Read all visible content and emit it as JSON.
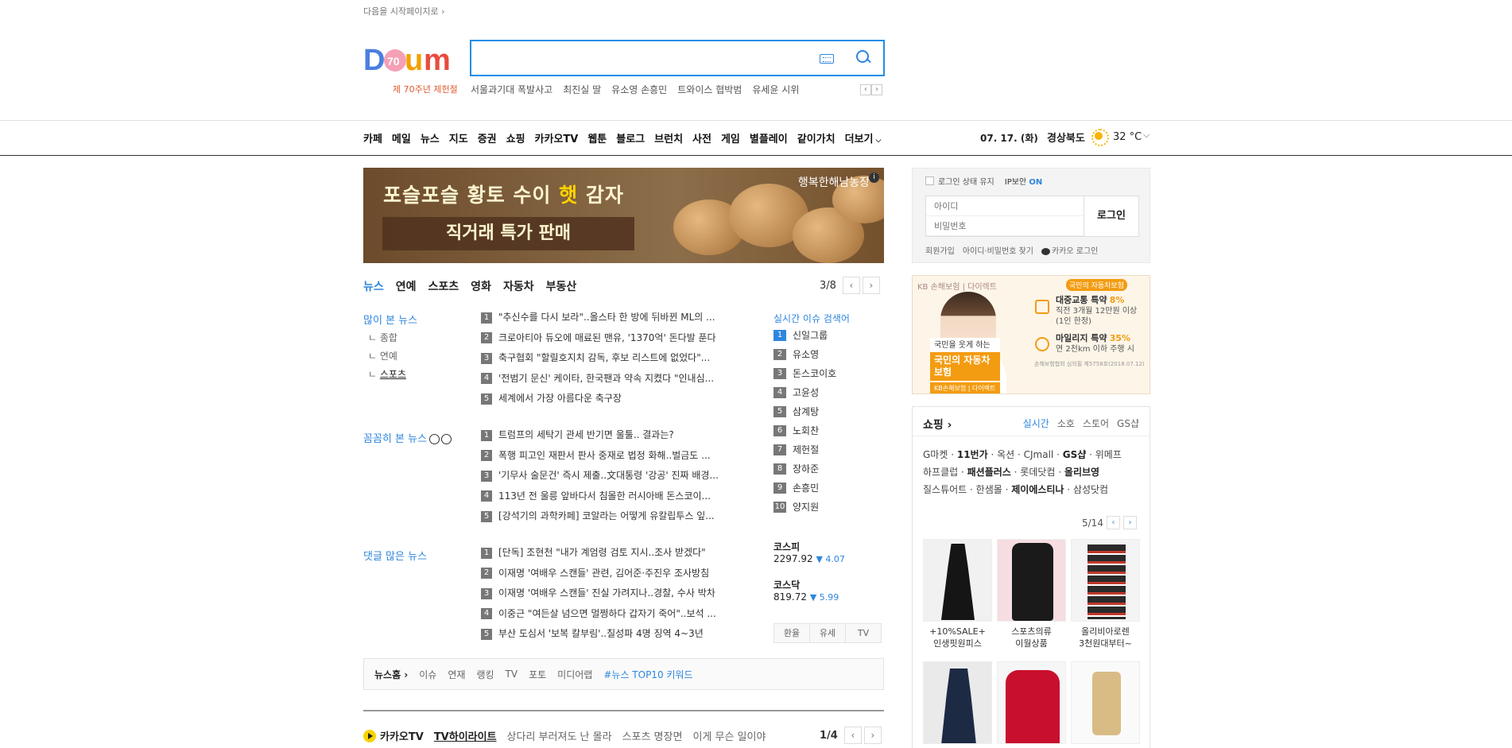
{
  "top": {
    "start_page": "다음을 시작페이지로 ›"
  },
  "logo": {
    "sub": "제 70주년 제헌절"
  },
  "search": {
    "placeholder": "",
    "trends": [
      "서울과기대 폭발사고",
      "최진실 딸",
      "유소영 손흥민",
      "트와이스 협박범",
      "유세윤 시위"
    ]
  },
  "gnb": [
    "카페",
    "메일",
    "뉴스",
    "지도",
    "증권",
    "쇼핑",
    "카카오TV",
    "웹툰",
    "블로그",
    "브런치",
    "사전",
    "게임",
    "별플레이",
    "같이가치",
    "더보기"
  ],
  "weather": {
    "date": "07. 17. (화)",
    "region": "경상북도",
    "temp": "32 °C"
  },
  "banner": {
    "line1a": "포슬포슬 황토 수이 ",
    "line1b": "햇",
    "line1c": " 감자",
    "line2": "직거래 특가 판매",
    "store": "행복한해남농장",
    "info": "i"
  },
  "news_tabs": {
    "tabs": [
      "뉴스",
      "연예",
      "스포츠",
      "영화",
      "자동차",
      "부동산"
    ],
    "page": "3/8"
  },
  "most_viewed": {
    "title": "많이 본 뉴스",
    "sub": [
      "종합",
      "연예",
      "스포츠"
    ],
    "items": [
      "\"추신수를 다시 보라\"..올스타 한 방에 뒤바뀐 ML의 ...",
      "크로아티아 듀오에 매료된 맨유, '1370억' 돈다발 푼다",
      "축구협회 \"할릴호지치 감독, 후보 리스트에 없었다\"...",
      "'전범기 문신' 케이타, 한국팬과 약속 지켰다 \"인내심...",
      "세계에서 가장 아름다운 축구장"
    ]
  },
  "careful_news": {
    "title": "꼼꼼히 본 뉴스",
    "items": [
      "트럼프의 세탁기 관세 반기면 울툴.. 결과는?",
      "폭행 피고인 재판서 판사 중재로 법정 화해..벌금도 ...",
      "'기무사 술문건' 즉시 제출..文대통령 '강공' 진짜 배경...",
      "113년 전 울릉 앞바다서 침몰한 러시아배 돈스코이...",
      "[강석기의 과학카페] 코알라는 어떻게 유칼립투스 잎..."
    ]
  },
  "comment_news": {
    "title": "댓글 많은 뉴스",
    "items": [
      "[단독] 조현천 \"내가 계엄령 검토 지시..조사 받겠다\"",
      "이재명 '여배우 스캔들' 관련, 김어준·주진우 조사방침",
      "이재명 '여배우 스캔들' 진실 가려지나..경찰, 수사 박차",
      "이중근 \"여든살 넘으면 멀쩡하다 갑자기 죽어\"..보석 ...",
      "부산 도심서 '보복 칼부림'..칠성파 4명 징역 4~3년"
    ]
  },
  "realtime": {
    "title": "실시간 이슈 검색어",
    "items": [
      "신일그룹",
      "유소영",
      "돈스코이호",
      "고윤성",
      "삼계탕",
      "노회찬",
      "제헌절",
      "장하준",
      "손흥민",
      "양지원"
    ]
  },
  "stocks": {
    "kospi": {
      "name": "코스피",
      "value": "2297.92",
      "delta": "▼ 4.07"
    },
    "kosdaq": {
      "name": "코스닥",
      "value": "819.72",
      "delta": "▼ 5.99"
    },
    "tabs": [
      "환율",
      "유세",
      "TV"
    ]
  },
  "newshome": {
    "home": "뉴스홈 ›",
    "links": [
      "이슈",
      "연재",
      "랭킹",
      "TV",
      "포토",
      "미디어랩"
    ],
    "keyword": "#뉴스 TOP10 키워드"
  },
  "kakaotv": {
    "label": "카카오TV",
    "tabs": [
      "TV하이라이트",
      "상다리 부러져도 난 몰라",
      "스포츠 명장면",
      "이게 무슨 일이야"
    ],
    "page": "1/4"
  },
  "login": {
    "keep": "로그인 상태 유지",
    "ipsec": "IP보안",
    "ipsec_state": "ON",
    "id_placeholder": "아이디",
    "pw_placeholder": "비밀번호",
    "button": "로그인",
    "links": [
      "회원가입",
      "아이디·비밀번호 찾기",
      "카카오 로그인"
    ]
  },
  "ad_kb": {
    "brand": "KB 손해보험 | 다이렉트",
    "tag": "국민의 자동차보험",
    "copy1": "국민을 웃게 하는",
    "copy2": "국민의 자동차보험",
    "copy3": "KB손해보험 | 다이렉트",
    "b1_title": "대중교통 특약",
    "b1_pct": "8%",
    "b1_l1": "직전 3개월 12만원 이상",
    "b1_l2": "(1인 한정)",
    "b2_title": "마일리지 특약",
    "b2_pct": "35%",
    "b2_l1": "연 2천km 이하 주행 시",
    "foot": "손해보험협회 심의필 제5758호(2018.07.12)"
  },
  "shopping": {
    "title": "쇼핑 ›",
    "tabs": [
      "실시간",
      "소호",
      "스토어",
      "GS샵"
    ],
    "malls": [
      [
        [
          "G마켓",
          false
        ],
        [
          "11번가",
          true
        ],
        [
          "옥션",
          false
        ],
        [
          "CJmall",
          false
        ],
        [
          "GS샵",
          true
        ],
        [
          "위메프",
          false
        ]
      ],
      [
        [
          "하프클럽",
          false
        ],
        [
          "패션플러스",
          true
        ],
        [
          "롯데닷컴",
          false
        ],
        [
          "올리브영",
          true
        ]
      ],
      [
        [
          "질스튜어트",
          false
        ],
        [
          "한샘몰",
          false
        ],
        [
          "제이에스티나",
          true
        ],
        [
          "삼성닷컴",
          false
        ]
      ]
    ],
    "page": "5/14",
    "products": [
      {
        "cap1": "+10%SALE+",
        "cap2": "인생핏원피스"
      },
      {
        "cap1": "스포츠의류",
        "cap2": "이월상품"
      },
      {
        "cap1": "올리비아로렌",
        "cap2": "3천원대부터~"
      }
    ]
  }
}
